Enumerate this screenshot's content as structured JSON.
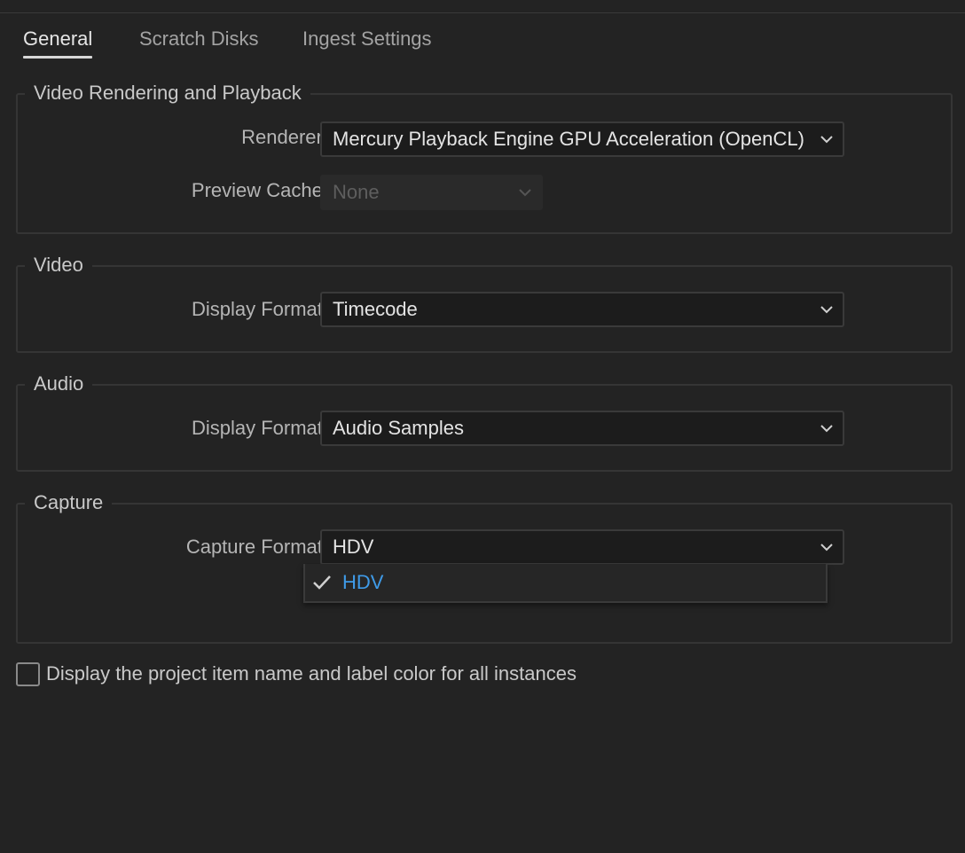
{
  "tabs": [
    {
      "label": "General",
      "active": true
    },
    {
      "label": "Scratch Disks",
      "active": false
    },
    {
      "label": "Ingest Settings",
      "active": false
    }
  ],
  "groups": {
    "rendering": {
      "legend": "Video Rendering and Playback",
      "renderer_label": "Renderer:",
      "renderer_value": "Mercury Playback Engine GPU Acceleration (OpenCL)",
      "preview_cache_label": "Preview Cache:",
      "preview_cache_value": "None"
    },
    "video": {
      "legend": "Video",
      "display_format_label": "Display Format:",
      "display_format_value": "Timecode"
    },
    "audio": {
      "legend": "Audio",
      "display_format_label": "Display Format:",
      "display_format_value": "Audio Samples"
    },
    "capture": {
      "legend": "Capture",
      "capture_format_label": "Capture Format:",
      "capture_format_value": "HDV",
      "options": [
        {
          "label": "HDV",
          "selected": true
        }
      ]
    }
  },
  "checkbox": {
    "label": "Display the project item name and label color for all instances",
    "checked": false
  },
  "colors": {
    "background": "#232323",
    "selected_option": "#3f9be8"
  },
  "icons": {
    "dropdown": "chevron-down-icon",
    "selected": "checkmark-icon"
  }
}
